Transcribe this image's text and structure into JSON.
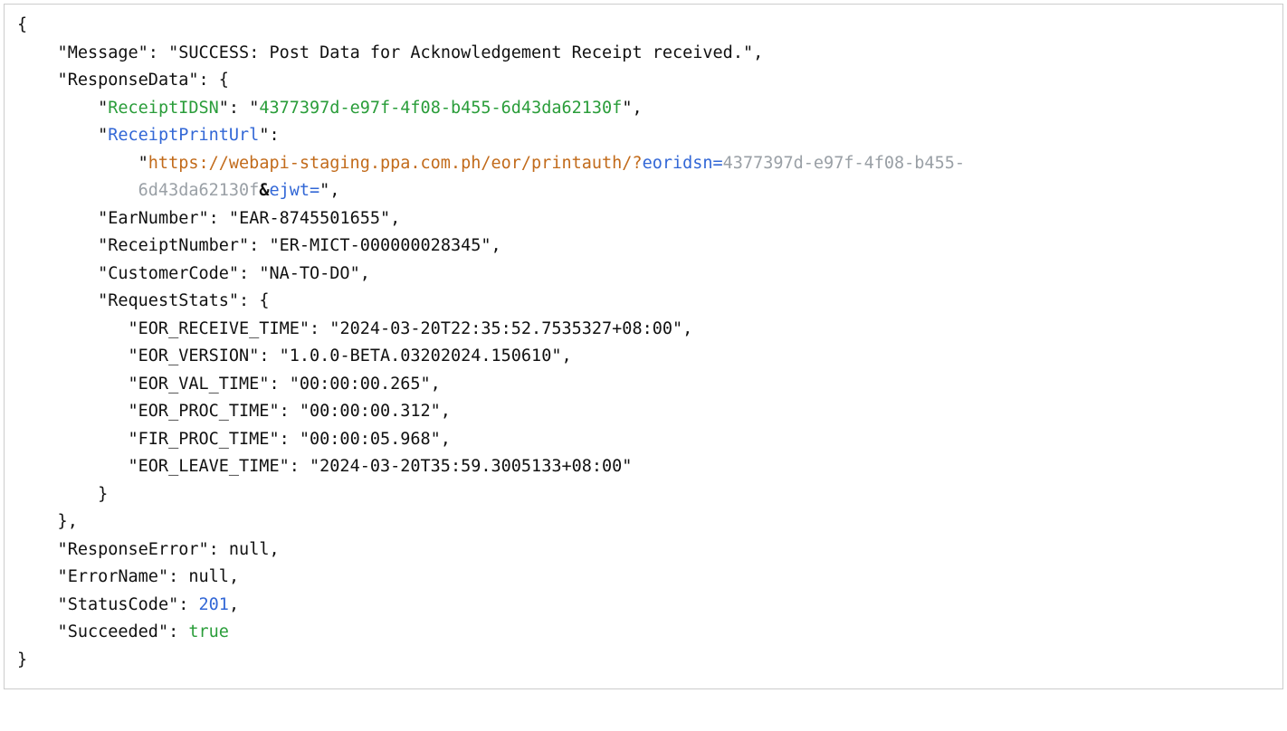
{
  "json": {
    "Message": "SUCCESS: Post Data for Acknowledgement Receipt received.",
    "ResponseData": {
      "ReceiptIDSN": "4377397d-e97f-4f08-b455-6d43da62130f",
      "ReceiptPrintUrl_base": "https://webapi-staging.ppa.com.ph/eor/printauth/?",
      "ReceiptPrintUrl_param_key": "eoridsn=",
      "ReceiptPrintUrl_param_val_line1": "4377397d-e97f-4f08-b455-",
      "ReceiptPrintUrl_param_val_line2": "6d43da62130f",
      "ReceiptPrintUrl_amp": "&",
      "ReceiptPrintUrl_param2_key": "ejwt=",
      "EarNumber": "EAR-8745501655",
      "ReceiptNumber": "ER-MICT-000000028345",
      "CustomerCode": "NA-TO-DO",
      "RequestStats": {
        "EOR_RECEIVE_TIME": "2024-03-20T22:35:52.7535327+08:00",
        "EOR_VERSION": "1.0.0-BETA.03202024.150610",
        "EOR_VAL_TIME": "00:00:00.265",
        "EOR_PROC_TIME": "00:00:00.312",
        "FIR_PROC_TIME": "00:00:05.968",
        "EOR_LEAVE_TIME": "2024-03-20T35:59.3005133+08:00"
      }
    },
    "ResponseError": "null",
    "ErrorName": "null",
    "StatusCode": "201",
    "Succeeded": "true"
  },
  "keys": {
    "Message": "Message",
    "ResponseData": "ResponseData",
    "ReceiptIDSN": "ReceiptIDSN",
    "ReceiptPrintUrl": "ReceiptPrintUrl",
    "EarNumber": "EarNumber",
    "ReceiptNumber": "ReceiptNumber",
    "CustomerCode": "CustomerCode",
    "RequestStats": "RequestStats",
    "EOR_RECEIVE_TIME": "EOR_RECEIVE_TIME",
    "EOR_VERSION": "EOR_VERSION",
    "EOR_VAL_TIME": "EOR_VAL_TIME",
    "EOR_PROC_TIME": "EOR_PROC_TIME",
    "FIR_PROC_TIME": "FIR_PROC_TIME",
    "EOR_LEAVE_TIME": "EOR_LEAVE_TIME",
    "ResponseError": "ResponseError",
    "ErrorName": "ErrorName",
    "StatusCode": "StatusCode",
    "Succeeded": "Succeeded"
  }
}
